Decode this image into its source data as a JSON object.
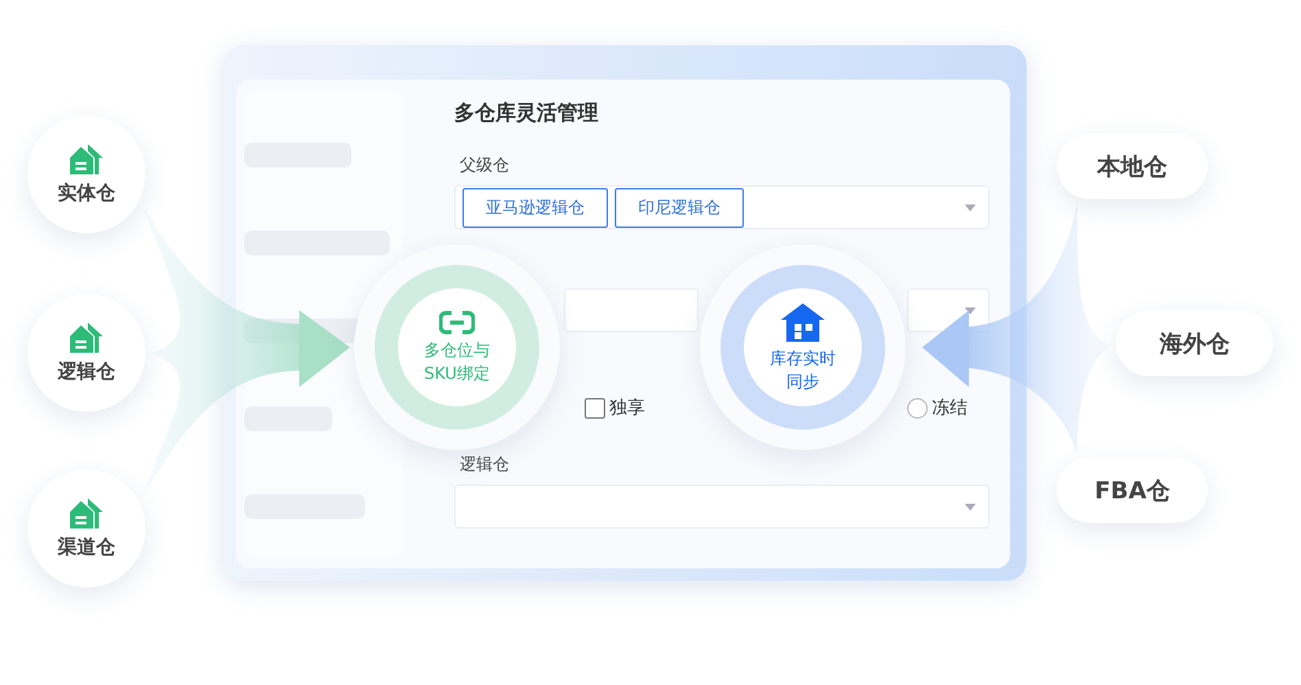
{
  "left_sources": [
    {
      "label": "实体仓"
    },
    {
      "label": "逻辑仓"
    },
    {
      "label": "渠道仓"
    }
  ],
  "right_sources": [
    {
      "label": "本地仓"
    },
    {
      "label": "海外仓"
    },
    {
      "label": "FBA仓"
    }
  ],
  "form": {
    "title": "多仓库灵活管理",
    "parent_field": {
      "label": "父级仓",
      "tags": [
        "亚马逊逻辑仓",
        "印尼逻辑仓"
      ]
    },
    "options": [
      {
        "kind": "checkbox",
        "label": "独享",
        "checked": false
      },
      {
        "kind": "radio",
        "label": "冻结",
        "selected": false
      }
    ],
    "logic_field": {
      "label": "逻辑仓"
    }
  },
  "hubs": [
    {
      "kind": "link",
      "lines": [
        "多仓位与",
        "SKU绑定"
      ],
      "color": "#2dbb78"
    },
    {
      "kind": "house",
      "lines": [
        "库存实时",
        "同步"
      ],
      "color": "#1668f0"
    }
  ]
}
